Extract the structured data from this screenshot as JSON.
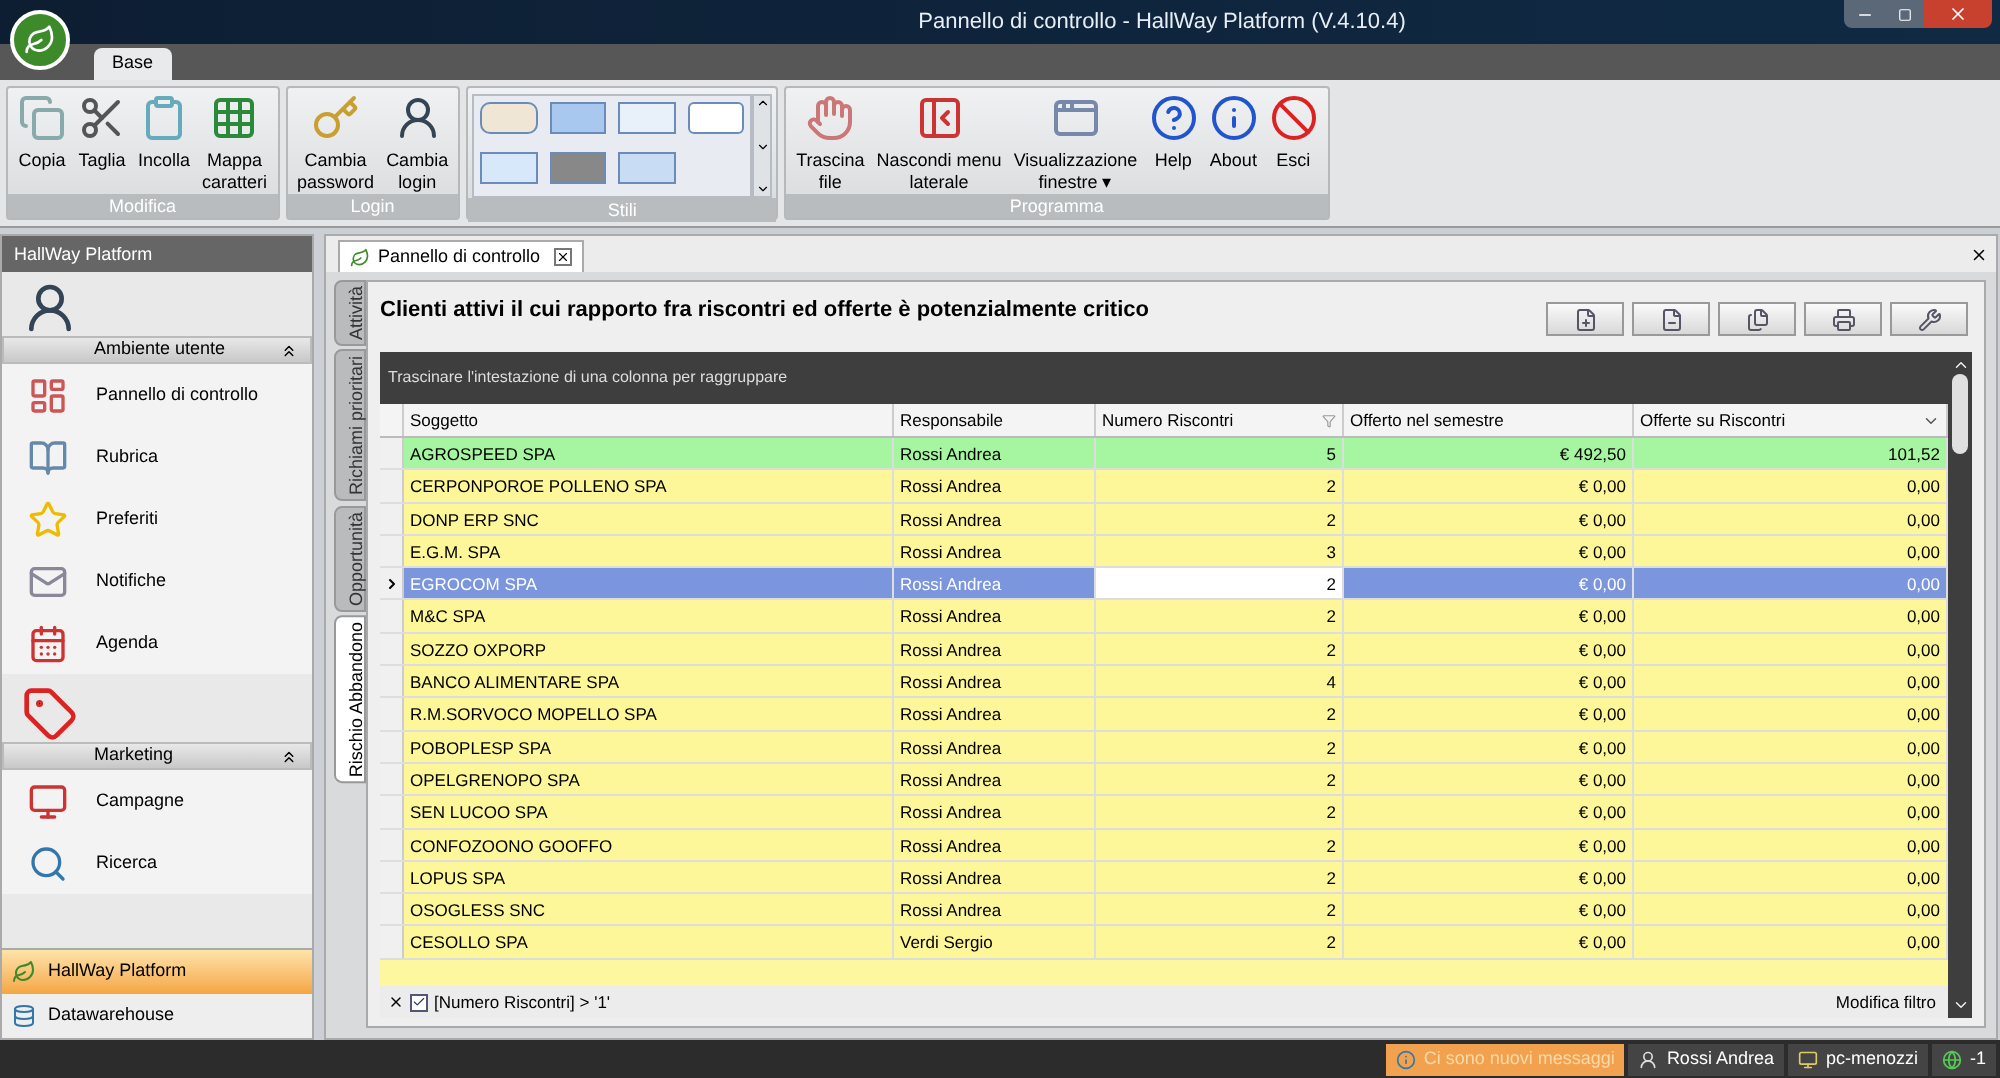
{
  "window": {
    "title": "Pannello di controllo - HallWay Platform (V.4.10.4)"
  },
  "ribbon_tabs": [
    {
      "label": "Base",
      "selected": true
    }
  ],
  "ribbon_groups": [
    {
      "title": "Modifica",
      "kind": "buttons",
      "buttons": [
        "Copia",
        "Taglia",
        "Incolla",
        "Mappa\ncaratteri"
      ]
    },
    {
      "title": "Login",
      "kind": "buttons",
      "buttons": [
        "Cambia\npassword",
        "Cambia\nlogin"
      ]
    },
    {
      "title": "Stili",
      "kind": "gallery"
    },
    {
      "title": "Programma",
      "kind": "buttons",
      "buttons": [
        "Trascina\nfile",
        "Nascondi menu\nlaterale",
        "Visualizzazione\nfinestre ▾",
        "Help",
        "About",
        "Esci"
      ]
    }
  ],
  "sidebar": {
    "title": "HallWay Platform",
    "groups": [
      {
        "title": "Ambiente utente",
        "items": [
          "Pannello di controllo",
          "Rubrica",
          "Preferiti",
          "Notifiche",
          "Agenda"
        ]
      },
      {
        "title": "Marketing",
        "items": [
          "Campagne",
          "Ricerca"
        ]
      }
    ],
    "modules": [
      {
        "label": "HallWay Platform",
        "selected": true
      },
      {
        "label": "Datawarehouse",
        "selected": false
      }
    ]
  },
  "document_tab": {
    "label": "Pannello di controllo"
  },
  "side_tabs": [
    {
      "label": "Attività",
      "selected": false
    },
    {
      "label": "Richiami prioritari",
      "selected": false
    },
    {
      "label": "Opportunità",
      "selected": false
    },
    {
      "label": "Rischio Abbandono",
      "selected": true
    }
  ],
  "panel": {
    "title": "Clienti attivi il cui rapporto fra riscontri ed offerte è potenzialmente critico"
  },
  "grid": {
    "group_hint": "Trascinare l'intestazione di una colonna per raggruppare",
    "columns": [
      "Soggetto",
      "Responsabile",
      "Numero Riscontri",
      "Offerto nel semestre",
      "Offerte su Riscontri"
    ],
    "rows": [
      {
        "cells": [
          "AGROSPEED SPA",
          "Rossi Andrea",
          "5",
          "€ 492,50",
          "101,52"
        ],
        "color": "#a6f5a0",
        "selected": false
      },
      {
        "cells": [
          "CERPONPOROE POLLENO SPA",
          "Rossi Andrea",
          "2",
          "€ 0,00",
          "0,00"
        ],
        "color": "#fdf79a",
        "selected": false
      },
      {
        "cells": [
          "DONP ERP SNC",
          "Rossi Andrea",
          "2",
          "€ 0,00",
          "0,00"
        ],
        "color": "#fdf79a",
        "selected": false
      },
      {
        "cells": [
          "E.G.M. SPA",
          "Rossi Andrea",
          "3",
          "€ 0,00",
          "0,00"
        ],
        "color": "#fdf79a",
        "selected": false
      },
      {
        "cells": [
          "EGROCOM SPA",
          "Rossi Andrea",
          "2",
          "€ 0,00",
          "0,00"
        ],
        "selected": true
      },
      {
        "cells": [
          "M&C SPA",
          "Rossi Andrea",
          "2",
          "€ 0,00",
          "0,00"
        ],
        "color": "#fdf79a",
        "selected": false
      },
      {
        "cells": [
          "SOZZO OXPORP",
          "Rossi Andrea",
          "2",
          "€ 0,00",
          "0,00"
        ],
        "color": "#fdf79a",
        "selected": false
      },
      {
        "cells": [
          "BANCO ALIMENTARE SPA",
          "Rossi Andrea",
          "4",
          "€ 0,00",
          "0,00"
        ],
        "color": "#fdf79a",
        "selected": false
      },
      {
        "cells": [
          "R.M.SORVOCO MOPELLO SPA",
          "Rossi Andrea",
          "2",
          "€ 0,00",
          "0,00"
        ],
        "color": "#fdf79a",
        "selected": false
      },
      {
        "cells": [
          "POBOPLESP SPA",
          "Rossi Andrea",
          "2",
          "€ 0,00",
          "0,00"
        ],
        "color": "#fdf79a",
        "selected": false
      },
      {
        "cells": [
          "OPELGRENOPO SPA",
          "Rossi Andrea",
          "2",
          "€ 0,00",
          "0,00"
        ],
        "color": "#fdf79a",
        "selected": false
      },
      {
        "cells": [
          "SEN LUCOO SPA",
          "Rossi Andrea",
          "2",
          "€ 0,00",
          "0,00"
        ],
        "color": "#fdf79a",
        "selected": false
      },
      {
        "cells": [
          "CONFOZOONO GOOFFO",
          "Rossi Andrea",
          "2",
          "€ 0,00",
          "0,00"
        ],
        "color": "#fdf79a",
        "selected": false
      },
      {
        "cells": [
          "LOPUS SPA",
          "Rossi Andrea",
          "2",
          "€ 0,00",
          "0,00"
        ],
        "color": "#fdf79a",
        "selected": false
      },
      {
        "cells": [
          "OSOGLESS SNC",
          "Rossi Andrea",
          "2",
          "€ 0,00",
          "0,00"
        ],
        "color": "#fdf79a",
        "selected": false
      },
      {
        "cells": [
          "CESOLLO SPA",
          "Verdi Sergio",
          "2",
          "€ 0,00",
          "0,00"
        ],
        "color": "#fdf79a",
        "selected": false
      }
    ],
    "filter": {
      "checked": true,
      "text": "[Numero Riscontri] > '1'",
      "edit_link": "Modifica filtro"
    }
  },
  "status_bar": [
    "Ci sono nuovi messaggi",
    "Rossi Andrea",
    "pc-menozzi",
    "-1"
  ]
}
